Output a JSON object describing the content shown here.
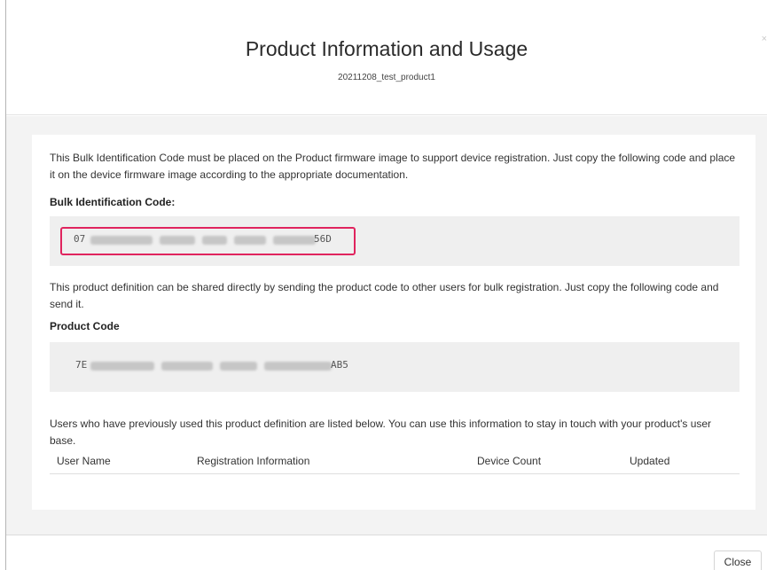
{
  "modal": {
    "title": "Product Information and Usage",
    "subtitle": "20211208_test_product1",
    "close_x": "×"
  },
  "bulk": {
    "description": "This Bulk Identification Code must be placed on the Product firmware image to support device registration. Just copy the following code and place it on the device firmware image according to the appropriate documentation.",
    "label": "Bulk Identification Code:",
    "code_visible_start": "07",
    "code_visible_end": "56D"
  },
  "product": {
    "description": "This product definition can be shared directly by sending the product code to other users for bulk registration. Just copy the following code and send it.",
    "label": "Product Code",
    "code_visible_start": "7E",
    "code_visible_end": "AB5"
  },
  "users": {
    "description": "Users who have previously used this product definition are listed below. You can use this information to stay in touch with your product's user base.",
    "columns": [
      "User Name",
      "Registration Information",
      "Device Count",
      "Updated"
    ]
  },
  "footer": {
    "close_label": "Close"
  },
  "colors": {
    "highlight": "#e0245e",
    "body_background": "#f3f3f3",
    "code_background": "#efefef"
  }
}
